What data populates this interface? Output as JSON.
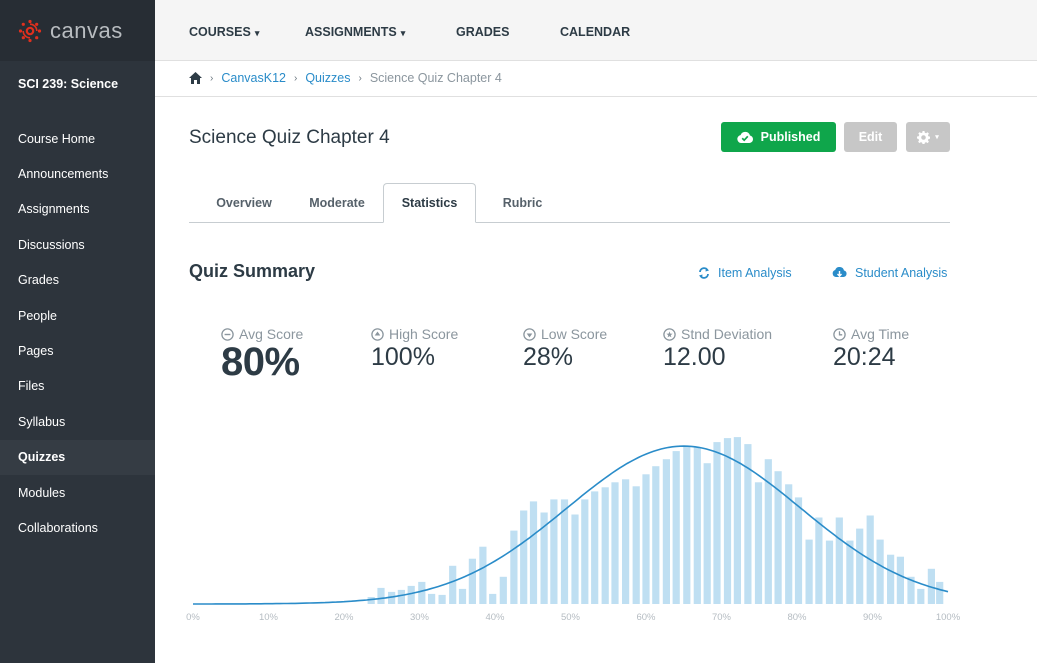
{
  "brand": {
    "name": "canvas",
    "logo_icon": "canvas-logo-icon",
    "logo_color": "#e0301e"
  },
  "sidebar": {
    "course_title": "SCI 239: Science",
    "items": [
      {
        "label": "Course Home",
        "active": false
      },
      {
        "label": "Announcements",
        "active": false
      },
      {
        "label": "Assignments",
        "active": false
      },
      {
        "label": "Discussions",
        "active": false
      },
      {
        "label": "Grades",
        "active": false
      },
      {
        "label": "People",
        "active": false
      },
      {
        "label": "Pages",
        "active": false
      },
      {
        "label": "Files",
        "active": false
      },
      {
        "label": "Syllabus",
        "active": false
      },
      {
        "label": "Quizzes",
        "active": true
      },
      {
        "label": "Modules",
        "active": false
      },
      {
        "label": "Collaborations",
        "active": false
      }
    ]
  },
  "topnav": {
    "items": [
      {
        "label": "COURSES",
        "dropdown": true
      },
      {
        "label": "ASSIGNMENTS",
        "dropdown": true
      },
      {
        "label": "GRADES",
        "dropdown": false
      },
      {
        "label": "CALENDAR",
        "dropdown": false
      }
    ],
    "caret": "▾"
  },
  "breadcrumb": {
    "home_icon": "home-icon",
    "separator": "›",
    "items": [
      {
        "label": "CanvasK12",
        "link": true
      },
      {
        "label": "Quizzes",
        "link": true
      },
      {
        "label": "Science Quiz Chapter 4",
        "link": false
      }
    ]
  },
  "header": {
    "title": "Science Quiz Chapter 4",
    "published_label": "Published",
    "edit_label": "Edit",
    "gear_caret": "▾",
    "colors": {
      "published": "#0fa64b",
      "disabled": "#c7c7c7"
    }
  },
  "tabs": [
    {
      "label": "Overview",
      "active": false
    },
    {
      "label": "Moderate",
      "active": false
    },
    {
      "label": "Statistics",
      "active": true
    },
    {
      "label": "Rubric",
      "active": false
    }
  ],
  "summary": {
    "title": "Quiz Summary",
    "item_analysis_label": "Item Analysis",
    "student_analysis_label": "Student Analysis",
    "link_color": "#2a8cc9",
    "stats": [
      {
        "label": "Avg Score",
        "value": "80%",
        "icon": "minus-circle-icon"
      },
      {
        "label": "High Score",
        "value": "100%",
        "icon": "up-circle-icon"
      },
      {
        "label": "Low Score",
        "value": "28%",
        "icon": "down-circle-icon"
      },
      {
        "label": "Stnd Deviation",
        "value": "12.00",
        "icon": "star-circle-icon"
      },
      {
        "label": "Avg Time",
        "value": "20:24",
        "icon": "clock-icon"
      }
    ]
  },
  "chart_data": {
    "type": "bar",
    "title": "",
    "xlabel": "",
    "ylabel": "",
    "xlim": [
      0,
      100
    ],
    "x_ticks": [
      "0%",
      "10%",
      "20%",
      "30%",
      "40%",
      "50%",
      "60%",
      "70%",
      "80%",
      "90%",
      "100%"
    ],
    "grid": false,
    "legend": "none",
    "bar_color": "#bfdff2",
    "curve_color": "#2a8cc9",
    "series": [
      {
        "name": "Score distribution",
        "type": "bar",
        "x": [
          23.6,
          24.9,
          26.3,
          27.6,
          28.9,
          30.3,
          31.6,
          33.0,
          34.4,
          35.7,
          37.0,
          38.4,
          39.7,
          41.1,
          42.5,
          43.8,
          45.1,
          46.5,
          47.8,
          49.2,
          50.6,
          51.9,
          53.2,
          54.6,
          55.9,
          57.3,
          58.7,
          60.0,
          61.3,
          62.7,
          64.0,
          65.4,
          66.8,
          68.1,
          69.4,
          70.8,
          72.1,
          73.5,
          74.9,
          76.2,
          77.5,
          78.9,
          80.2,
          81.6,
          82.9,
          84.3,
          85.6,
          87.0,
          88.3,
          89.7,
          91.0,
          92.4,
          93.7,
          95.1,
          96.4,
          97.8,
          98.9
        ],
        "values": [
          7,
          16,
          12,
          14,
          18,
          22,
          10,
          9,
          38,
          15,
          45,
          57,
          10,
          27,
          73,
          93,
          102,
          91,
          104,
          104,
          89,
          104,
          112,
          116,
          121,
          124,
          117,
          129,
          137,
          144,
          152,
          157,
          156,
          140,
          161,
          165,
          166,
          159,
          121,
          144,
          132,
          119,
          106,
          64,
          86,
          63,
          86,
          63,
          75,
          88,
          64,
          49,
          47,
          27,
          15,
          35,
          22
        ]
      },
      {
        "name": "Normal fit",
        "type": "line",
        "mean": 65,
        "std_dev": 15.5,
        "peak": 157
      }
    ],
    "ylim": [
      0,
      175
    ]
  }
}
